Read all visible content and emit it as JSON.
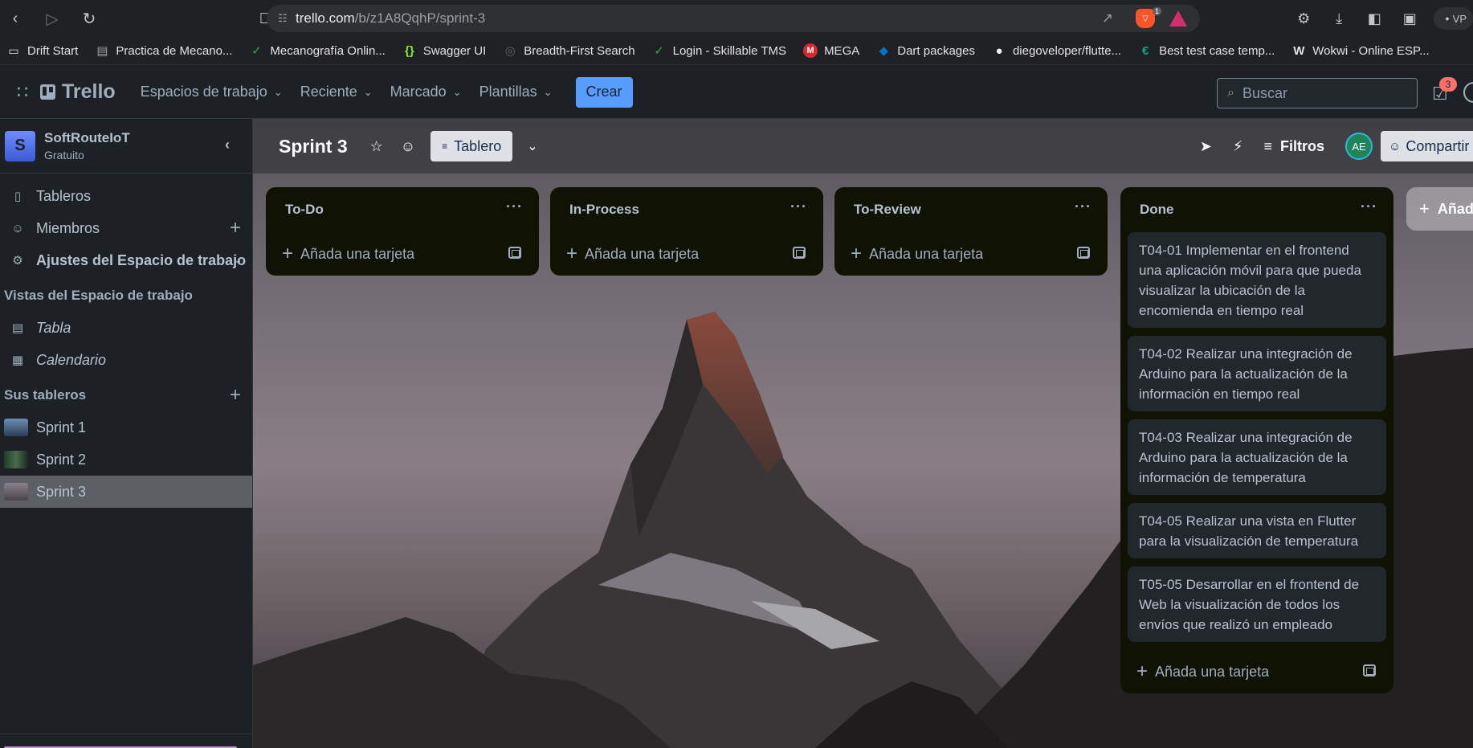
{
  "browser": {
    "url_domain": "trello.com",
    "url_path": "/b/z1A8QqhP/sprint-3",
    "brave_badge": "1",
    "vpn_label": "VP"
  },
  "bookmarks": [
    {
      "label": "Drift Start",
      "icon": "document-icon",
      "color": "#202124"
    },
    {
      "label": "Practica de Mecano...",
      "icon": "page-icon",
      "color": "#9aa0a6"
    },
    {
      "label": "Mecanografía Onlin...",
      "icon": "check-icon",
      "color": "#34a853"
    },
    {
      "label": "Swagger UI",
      "icon": "swagger-icon",
      "color": "#85ea2d"
    },
    {
      "label": "Breadth-First Search",
      "icon": "globe-icon",
      "color": "#5f6368"
    },
    {
      "label": "Login - Skillable TMS",
      "icon": "check-icon",
      "color": "#34a853"
    },
    {
      "label": "MEGA",
      "icon": "mega-icon",
      "color": "#d9272e"
    },
    {
      "label": "Dart packages",
      "icon": "dart-icon",
      "color": "#0175c2"
    },
    {
      "label": "diegoveloper/flutte...",
      "icon": "github-icon",
      "color": "#f0f0f0"
    },
    {
      "label": "Best test case temp...",
      "icon": "euro-icon",
      "color": "#00a884"
    },
    {
      "label": "Wokwi - Online ESP...",
      "icon": "wokwi-icon",
      "color": "#e3e3e3"
    }
  ],
  "header": {
    "logo": "Trello",
    "menus": [
      "Espacios de trabajo",
      "Reciente",
      "Marcado",
      "Plantillas"
    ],
    "create_label": "Crear",
    "search_placeholder": "Buscar",
    "notifications_count": "3"
  },
  "sidebar": {
    "workspace_initial": "S",
    "workspace_name": "SoftRouteIoT",
    "workspace_plan": "Gratuito",
    "items": [
      {
        "label": "Tableros",
        "icon": "board-icon"
      },
      {
        "label": "Miembros",
        "icon": "person-icon"
      },
      {
        "label": "Ajustes del Espacio de trabajo",
        "icon": "gear-icon"
      }
    ],
    "views_heading": "Vistas del Espacio de trabajo",
    "views": [
      {
        "label": "Tabla",
        "icon": "table-icon"
      },
      {
        "label": "Calendario",
        "icon": "calendar-icon"
      }
    ],
    "boards_heading": "Sus tableros",
    "boards": [
      {
        "label": "Sprint 1",
        "active": false
      },
      {
        "label": "Sprint 2",
        "active": false
      },
      {
        "label": "Sprint 3",
        "active": true
      }
    ]
  },
  "board": {
    "title": "Sprint 3",
    "view_label": "Tablero",
    "filters_label": "Filtros",
    "member_initials": "AE",
    "share_label": "Compartir",
    "add_list_label": "Añad",
    "lists": [
      {
        "title": "To-Do",
        "add_card": "Añada una tarjeta",
        "cards": []
      },
      {
        "title": "In-Process",
        "add_card": "Añada una tarjeta",
        "cards": []
      },
      {
        "title": "To-Review",
        "add_card": "Añada una tarjeta",
        "cards": []
      },
      {
        "title": "Done",
        "add_card": "Añada una tarjeta",
        "cards": [
          "T04-01 Implementar en el frontend una aplicación móvil para que pueda visualizar la ubicación de la encomienda en tiempo real",
          "T04-02 Realizar una integración de Arduino para la actualización de la información en tiempo real",
          "T04-03 Realizar una integración de Arduino para la actualización de la información de temperatura",
          "T04-05 Realizar una vista en Flutter para la visualización de temperatura",
          "T05-05 Desarrollar en el frontend de Web la visualización de todos los envíos que realizó un empleado"
        ]
      }
    ]
  }
}
